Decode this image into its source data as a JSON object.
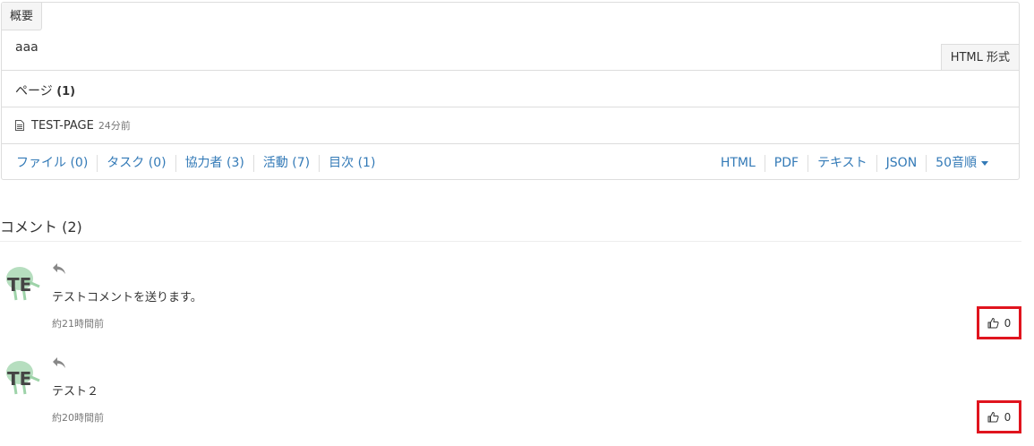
{
  "summary": {
    "tab_label": "概要",
    "text": "aaa",
    "html_format_label": "HTML 形式"
  },
  "pages": {
    "title": "ページ",
    "count": "(1)",
    "items": [
      {
        "name": "TEST-PAGE",
        "age": "24分前",
        "icon": "document-icon"
      }
    ]
  },
  "footer_links_left": [
    "ファイル (0)",
    "タスク (0)",
    "協力者 (3)",
    "活動 (7)",
    "目次 (1)"
  ],
  "footer_links_right": [
    "HTML",
    "PDF",
    "テキスト",
    "JSON",
    "50音順"
  ],
  "comments": {
    "title": "コメント",
    "count": "(2)",
    "items": [
      {
        "avatar_text": "TE",
        "text": "テストコメントを送ります。",
        "time": "約21時間前",
        "likes": "0"
      },
      {
        "avatar_text": "TE",
        "text": "テスト２",
        "time": "約20時間前",
        "likes": "0"
      }
    ]
  },
  "colors": {
    "link": "#337ab7",
    "highlight": "#e0141e",
    "border": "#dddddd"
  }
}
